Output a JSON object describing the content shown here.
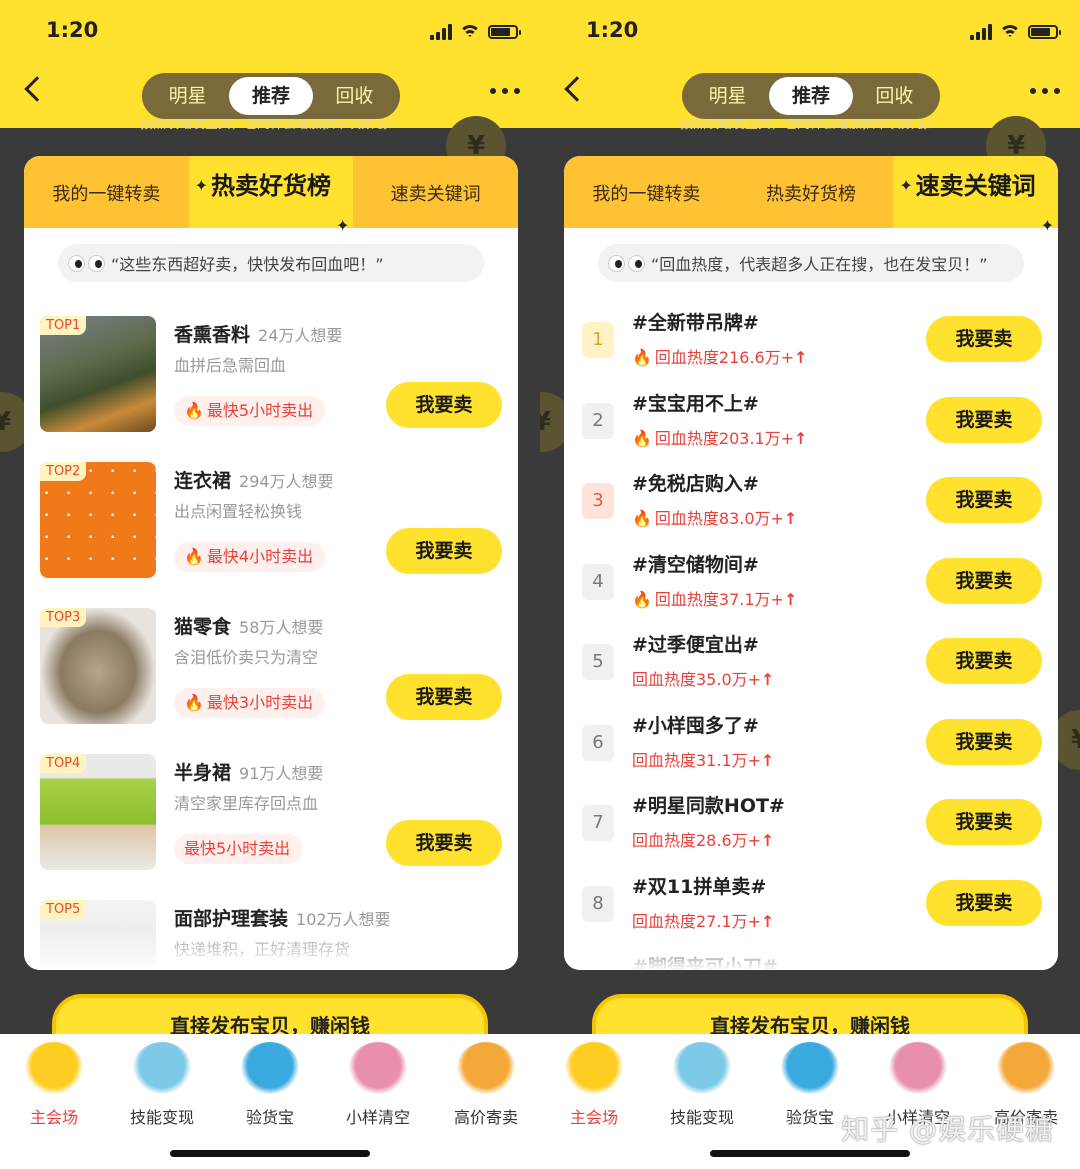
{
  "status": {
    "time": "1:20"
  },
  "nav": {
    "tabs": [
      "明星",
      "推荐",
      "回收"
    ],
    "active_tab": "推荐"
  },
  "hint_strip": "按照攻略发宝贝，也同样会增加抽卡次数哦！",
  "left": {
    "tabs": [
      "我的一键转卖",
      "热卖好货榜",
      "速卖关键词"
    ],
    "active_tab": 1,
    "quote": "“这些东西超好卖，快快发布回血吧！”",
    "products": [
      {
        "rank": "TOP1",
        "name": "香熏香料",
        "want": "24万人想要",
        "sub": "血拼后急需回血",
        "badge": "最快5小时卖出",
        "fire": true,
        "sell": "我要卖",
        "img": "lavender"
      },
      {
        "rank": "TOP2",
        "name": "连衣裙",
        "want": "294万人想要",
        "sub": "出点闲置轻松换钱",
        "badge": "最快4小时卖出",
        "fire": true,
        "sell": "我要卖",
        "img": "dress"
      },
      {
        "rank": "TOP3",
        "name": "猫零食",
        "want": "58万人想要",
        "sub": "含泪低价卖只为清空",
        "badge": "最快3小时卖出",
        "fire": true,
        "sell": "我要卖",
        "img": "fish"
      },
      {
        "rank": "TOP4",
        "name": "半身裙",
        "want": "91万人想要",
        "sub": "清空家里库存回点血",
        "badge": "最快5小时卖出",
        "fire": false,
        "sell": "我要卖",
        "img": "skirt"
      },
      {
        "rank": "TOP5",
        "name": "面部护理套装",
        "want": "102万人想要",
        "sub": "快递堆积，正好清理存货",
        "badge": "",
        "fire": false,
        "sell": "",
        "img": "bottles"
      }
    ]
  },
  "right": {
    "tabs": [
      "我的一键转卖",
      "热卖好货榜",
      "速卖关键词"
    ],
    "active_tab": 2,
    "quote": "“回血热度，代表超多人正在搜，也在发宝贝！”",
    "keywords": [
      {
        "rank": "1",
        "title": "#全新带吊牌#",
        "heat": "回血热度216.6万+",
        "fire": true,
        "sell": "我要卖"
      },
      {
        "rank": "2",
        "title": "#宝宝用不上#",
        "heat": "回血热度203.1万+",
        "fire": true,
        "sell": "我要卖"
      },
      {
        "rank": "3",
        "title": "#免税店购入#",
        "heat": "回血热度83.0万+",
        "fire": true,
        "sell": "我要卖"
      },
      {
        "rank": "4",
        "title": "#清空储物间#",
        "heat": "回血热度37.1万+",
        "fire": true,
        "sell": "我要卖"
      },
      {
        "rank": "5",
        "title": "#过季便宜出#",
        "heat": "回血热度35.0万+",
        "fire": false,
        "sell": "我要卖"
      },
      {
        "rank": "6",
        "title": "#小样囤多了#",
        "heat": "回血热度31.1万+",
        "fire": false,
        "sell": "我要卖"
      },
      {
        "rank": "7",
        "title": "#明星同款HOT#",
        "heat": "回血热度28.6万+",
        "fire": false,
        "sell": "我要卖"
      },
      {
        "rank": "8",
        "title": "#双11拼单卖#",
        "heat": "回血热度27.1万+",
        "fire": false,
        "sell": "我要卖"
      },
      {
        "rank": "",
        "title": "#脚得来可小刀#",
        "heat": "",
        "fire": false,
        "sell": ""
      }
    ]
  },
  "publish_button": "直接发布宝贝，赚闲钱",
  "tabbar": [
    {
      "label": "主会场",
      "active": true,
      "color": "#ffcc22"
    },
    {
      "label": "技能变现",
      "active": false,
      "color": "#7cc9e8"
    },
    {
      "label": "验货宝",
      "active": false,
      "color": "#3aa9e0"
    },
    {
      "label": "小样清空",
      "active": false,
      "color": "#e88fb0"
    },
    {
      "label": "高价寄卖",
      "active": false,
      "color": "#f5a83a"
    }
  ],
  "watermark": "知乎 @娱乐硬糖",
  "colors": {
    "brand_yellow": "#ffe12e",
    "accent_red": "#e8403a",
    "dark_bg": "#3b3a3a"
  }
}
